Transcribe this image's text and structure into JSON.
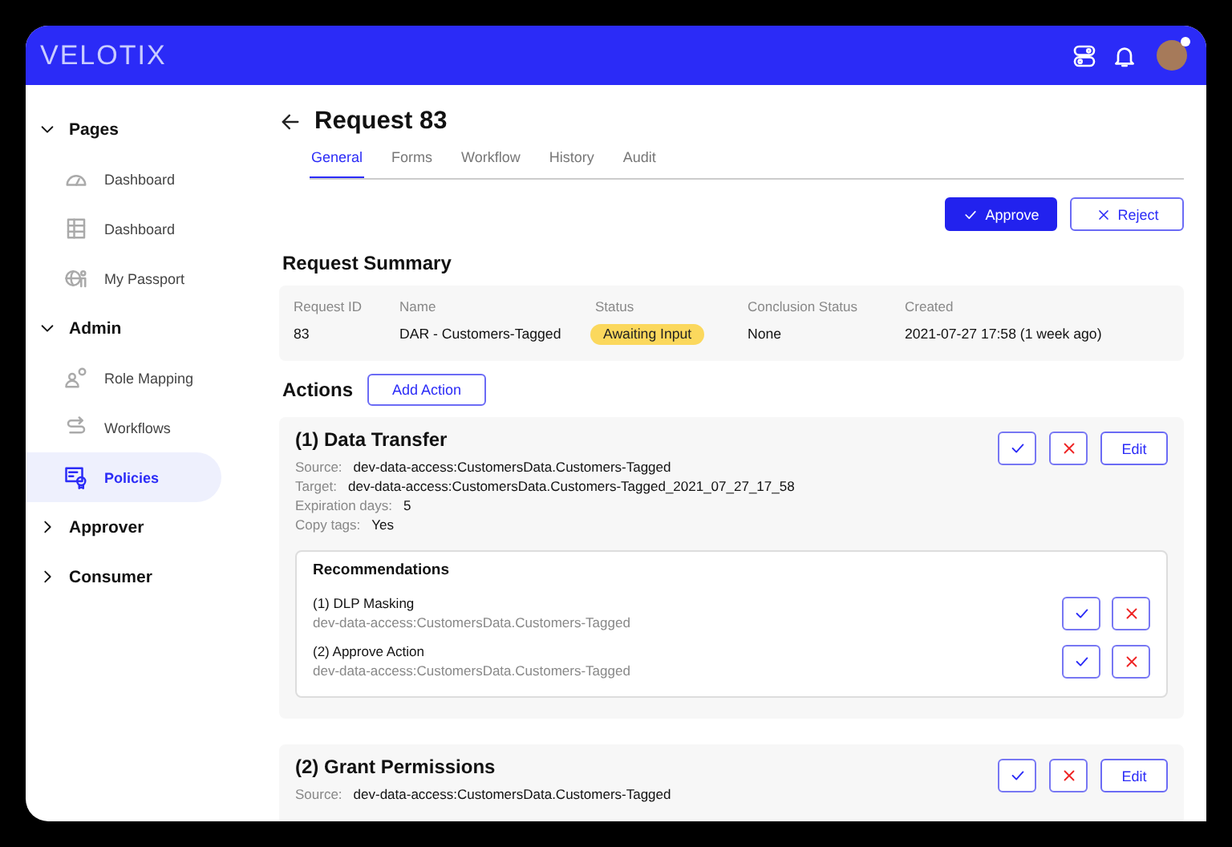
{
  "header": {
    "logo": "VELOTIX",
    "avatar": {
      "online": true
    }
  },
  "sidebar": {
    "sections": [
      {
        "label": "Pages",
        "expanded": true,
        "items": [
          {
            "label": "Dashboard",
            "kind": "gauge",
            "selected": false
          },
          {
            "label": "Dashboard",
            "kind": "table",
            "selected": false
          },
          {
            "label": "My Passport",
            "kind": "globe",
            "selected": false
          }
        ]
      },
      {
        "label": "Admin",
        "expanded": true,
        "items": [
          {
            "label": "Role Mapping",
            "kind": "roles",
            "selected": false
          },
          {
            "label": "Workflows",
            "kind": "flow",
            "selected": false
          },
          {
            "label": "Policies",
            "kind": "policy",
            "selected": true
          }
        ]
      },
      {
        "label": "Approver",
        "expanded": false
      },
      {
        "label": "Consumer",
        "expanded": false
      }
    ]
  },
  "page": {
    "title": "Request 83",
    "tabs": [
      {
        "label": "General",
        "selected": true
      },
      {
        "label": "Forms",
        "selected": false
      },
      {
        "label": "Workflow",
        "selected": false
      },
      {
        "label": "History",
        "selected": false
      },
      {
        "label": "Audit",
        "selected": false
      }
    ],
    "buttons": [
      {
        "kind": "approve",
        "label": "Approve"
      },
      {
        "kind": "reject",
        "label": "Reject"
      }
    ],
    "summary": {
      "title": "Request Summary",
      "columns": [
        {
          "header": "Request ID",
          "value": "83",
          "kind": "text"
        },
        {
          "header": "Name",
          "value": "DAR - Customers-Tagged",
          "kind": "text"
        },
        {
          "header": "Status",
          "value": "Awaiting Input",
          "kind": "badge"
        },
        {
          "header": "Conclusion Status",
          "value": "None",
          "kind": "text"
        },
        {
          "header": "Created",
          "value": "2021-07-27 17:58 (1 week ago)",
          "kind": "text"
        }
      ]
    },
    "actions": {
      "title": "Actions",
      "add_button": "Add Action",
      "cards": [
        {
          "title": "(1) Data Transfer",
          "edit": "Edit",
          "fields": [
            {
              "label": "Source:",
              "value": "dev-data-access:CustomersData.Customers-Tagged"
            },
            {
              "label": "Target:",
              "value": "dev-data-access:CustomersData.Customers-Tagged_2021_07_27_17_58"
            },
            {
              "label": "Expiration days:",
              "value": "5"
            },
            {
              "label": "Copy tags:",
              "value": "Yes"
            }
          ],
          "recommendations": {
            "title": "Recommendations",
            "items": [
              {
                "title": "(1) DLP Masking",
                "path": "dev-data-access:CustomersData.Customers-Tagged"
              },
              {
                "title": "(2) Approve Action",
                "path": "dev-data-access:CustomersData.Customers-Tagged"
              }
            ]
          }
        },
        {
          "title": "(2) Grant Permissions",
          "edit": "Edit",
          "fields": [
            {
              "label": "Source:",
              "value": "dev-data-access:CustomersData.Customers-Tagged"
            }
          ]
        }
      ]
    }
  }
}
